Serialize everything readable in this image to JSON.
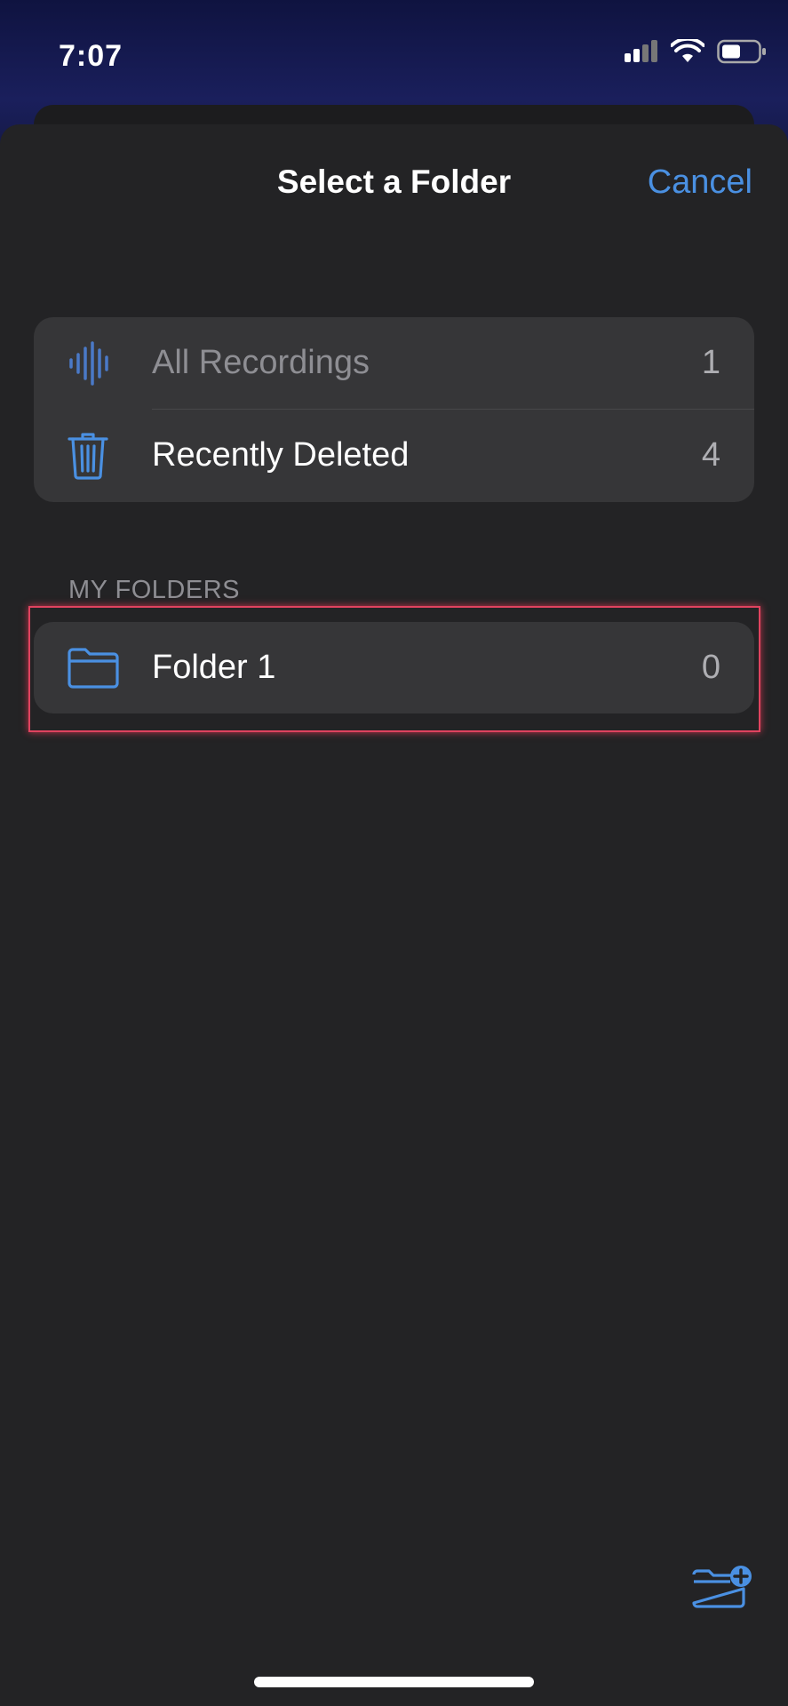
{
  "status_bar": {
    "time": "7:07"
  },
  "header": {
    "title": "Select a Folder",
    "cancel_label": "Cancel"
  },
  "library": [
    {
      "label": "All Recordings",
      "count": "1",
      "icon": "waveform-icon"
    },
    {
      "label": "Recently Deleted",
      "count": "4",
      "icon": "trash-icon"
    }
  ],
  "my_folders": {
    "section_title": "MY FOLDERS",
    "items": [
      {
        "label": "Folder 1",
        "count": "0",
        "icon": "folder-icon"
      }
    ]
  },
  "toolbar": {
    "new_folder_icon": "new-folder-icon"
  },
  "colors": {
    "accent": "#4a90e2",
    "sheet": "#232325",
    "row": "#363638",
    "highlight": "#e0435f"
  }
}
